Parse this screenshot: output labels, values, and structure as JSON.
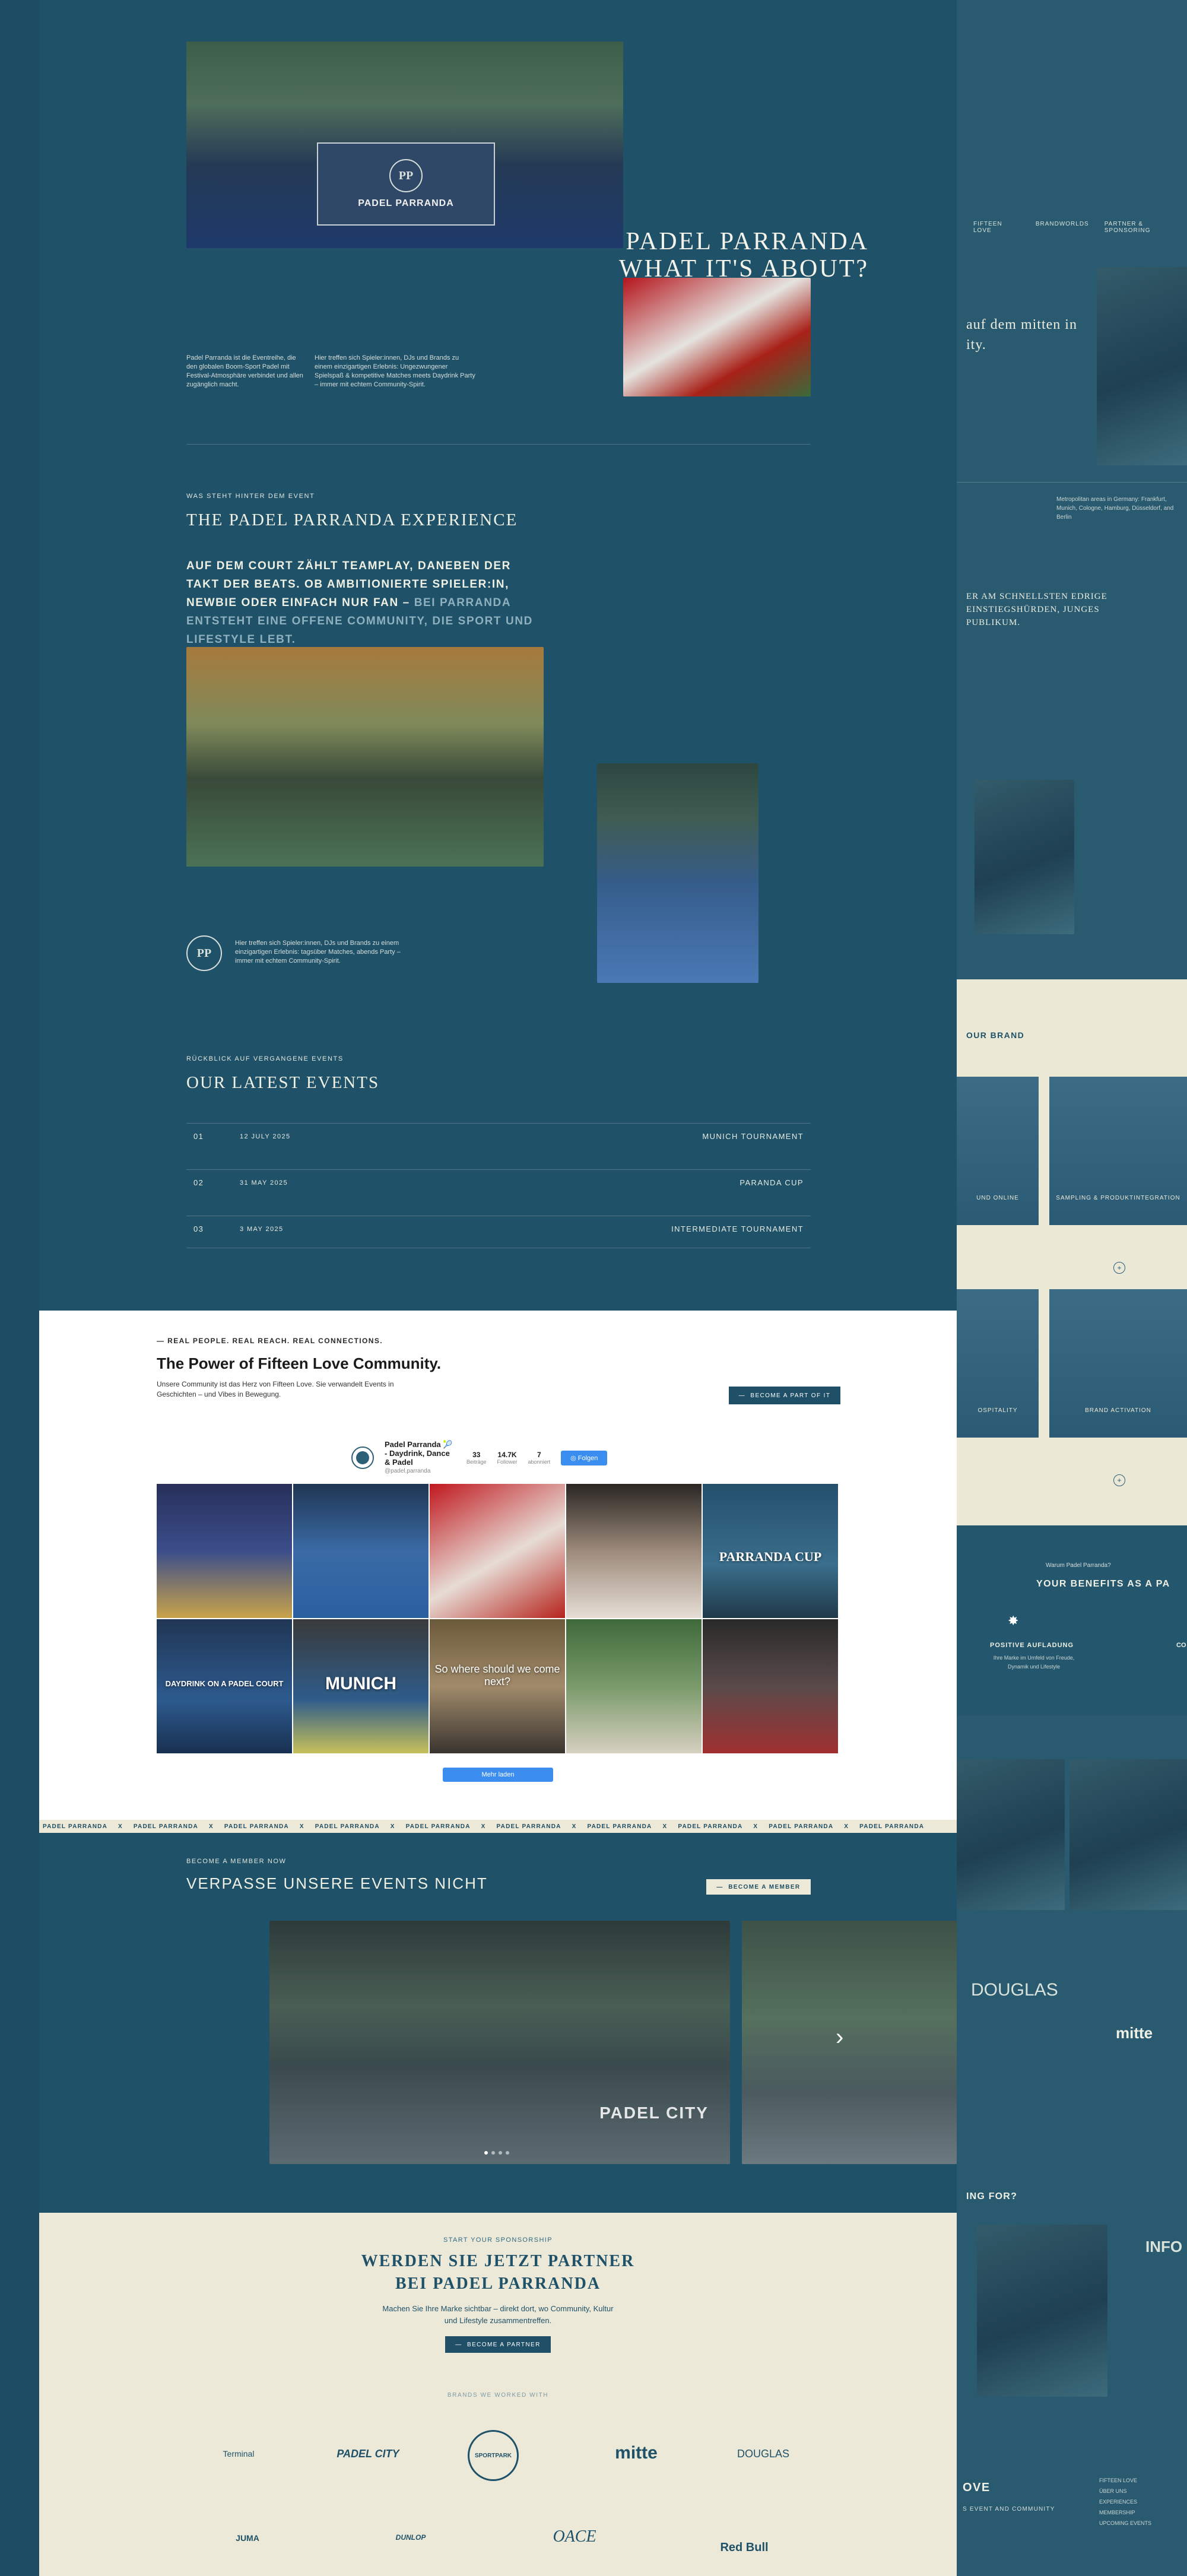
{
  "hero": {
    "title_line1": "PADEL PARRANDA",
    "title_line2": "WHAT IT'S ABOUT?",
    "banner_text": "PADEL PARRANDA",
    "text_left": "Padel Parranda ist die Eventreihe, die den globalen Boom-Sport Padel mit Festival-Atmosphäre verbindet und allen zugänglich macht.",
    "text_right": "Hier treffen sich Spieler:innen, DJs und Brands zu einem einzigartigen Erlebnis: Ungezwungener Spielspaß & kompetitive Matches meets Daydrink Party – immer mit echtem Community-Spirit."
  },
  "experience": {
    "eyebrow": "WAS STEHT HINTER DEM EVENT",
    "title": "THE PADEL PARRANDA EXPERIENCE",
    "quote": "AUF DEM COURT ZÄHLT TEAMPLAY, DANEBEN DER TAKT DER BEATS. OB AMBITIONIERTE SPIELER:IN, NEWBIE ODER EINFACH NUR FAN –",
    "quote_faded": "BEI PARRANDA ENTSTEHT EINE OFFENE COMMUNITY, DIE SPORT UND LIFESTYLE LEBT.",
    "seal_text": "PP",
    "seal_caption": "Hier treffen sich Spieler:innen, DJs und Brands zu einem einzigartigen Erlebnis: tagsüber Matches, abends Party – immer mit echtem Community-Spirit."
  },
  "events": {
    "eyebrow": "RÜCKBLICK AUF VERGANGENE EVENTS",
    "title": "OUR LATEST EVENTS",
    "rows": [
      {
        "num": "01",
        "date": "12 JULY 2025",
        "name": "MUNICH TOURNAMENT"
      },
      {
        "num": "02",
        "date": "31 MAY 2025",
        "name": "PARANDA CUP"
      },
      {
        "num": "03",
        "date": "3 MAY 2025",
        "name": "INTERMEDIATE TOURNAMENT"
      }
    ]
  },
  "community": {
    "eyebrow": "REAL PEOPLE. REAL REACH. REAL CONNECTIONS.",
    "title": "The Power of Fifteen Love Community.",
    "desc": "Unsere Community ist das Herz von Fifteen Love. Sie verwandelt Events in Geschichten – und Vibes in Bewegung.",
    "cta": "BECOME A PART OF IT",
    "profile_name": "Padel Parranda 🎾 - Daydrink, Dance & Padel",
    "profile_handle": "@padel.parranda",
    "posts_value": "33",
    "posts_label": "Beiträge",
    "followers_value": "14.7K",
    "followers_label": "Follower",
    "following_value": "7",
    "following_label": "abonniert",
    "follow_label": "Folgen",
    "grid_captions": [
      "",
      "",
      "",
      "",
      "PARRANDA CUP",
      "DAYDRINK ON A PADEL COURT",
      "MUNICH",
      "So where should we come next?",
      "",
      ""
    ],
    "more_label": "Mehr laden"
  },
  "marquee": {
    "items": [
      "PADEL PARRANDA",
      "X",
      "PADEL PARRANDA",
      "X",
      "PADEL PARRANDA",
      "X",
      "PADEL PARRANDA",
      "X",
      "PADEL PARRANDA",
      "X",
      "PADEL PARRANDA",
      "X",
      "PADEL PARRANDA",
      "X",
      "PADEL PARRANDA",
      "X",
      "PADEL PARRANDA",
      "X",
      "PADEL PARRANDA"
    ]
  },
  "member": {
    "eyebrow": "BECOME A MEMBER NOW",
    "title": "VERPASSE UNSERE EVENTS NICHT",
    "cta": "BECOME A MEMBER",
    "slide_caption": "PADEL CITY",
    "next_icon": "chevron-right-icon"
  },
  "sponsor": {
    "eyebrow": "START YOUR SPONSORSHIP",
    "title_line1": "WERDEN SIE JETZT PARTNER",
    "title_line2": "BEI PADEL PARRANDA",
    "desc_line1": "Machen Sie Ihre Marke sichtbar – direkt dort, wo Community, Kultur",
    "desc_line2": "und Lifestyle zusammentreffen.",
    "cta": "BECOME A PARTNER",
    "worked_with": "BRANDS WE WORKED WITH",
    "logos": [
      "Terminal",
      "PADEL CITY",
      "SPORTPARK",
      "mitte",
      "DOUGLAS",
      "JUMA",
      "DUNLOP",
      "OACE",
      "Red Bull"
    ]
  },
  "ghost": {
    "nav": [
      "FIFTEEN LOVE",
      "BRANDWORLDS",
      "PARTNER & SPONSORING"
    ],
    "heading": "auf dem mitten in ity.",
    "cities": "Metropolitan areas in Germany: Frankfurt, Munich, Cologne, Hamburg, Düsseldorf, and Berlin",
    "audience": "ER AM SCHNELLSTEN EDRIGE EINSTIEGSHÜRDEN, JUNGES PUBLIKUM.",
    "brand_label": "OUR BRAND",
    "tiles": [
      "UND ONLINE",
      "SAMPLING & PRODUKTINTEGRATION",
      "OSPITALITY",
      "BRAND ACTIVATION"
    ],
    "benefits_eyebrow": "Warum Padel Parranda?",
    "benefits_title": "YOUR BENEFITS AS A PA",
    "benefit_1": "POSITIVE AUFLADUNG",
    "benefit_1_text": "Ihre Marke im Umfeld von Freude, Dynamik und Lifestyle",
    "benefit_2": "CO",
    "ghost_logo_1": "DOUGLAS",
    "ghost_logo_2": "mitte",
    "looking_for": "ING FOR?",
    "info_label": "INFO",
    "footer_love": "OVE",
    "footer_event": "S EVENT AND COMMUNITY",
    "footer_links": [
      "FIFTEEN LOVE",
      "ÜBER UNS",
      "EXPERIENCES",
      "MEMBERSHIP",
      "UPCOMING EVENTS"
    ]
  }
}
